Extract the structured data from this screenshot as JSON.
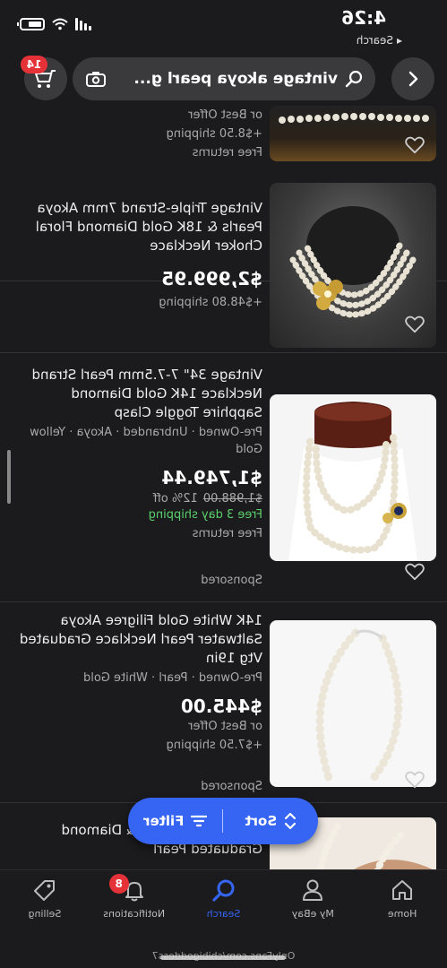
{
  "status": {
    "time": "4:26",
    "back_app": "Search"
  },
  "search": {
    "query": "vintage akoya pearl g...",
    "cart_count": "14"
  },
  "listings": [
    {
      "title": "",
      "price": "",
      "offer": "or Best Offer",
      "shipping": "+$8.50 shipping",
      "returns": "Free returns"
    },
    {
      "title": "Vintage Triple-Strand 7mm Akoya Pearls & 18K Gold Diamond Floral Choker Necklace",
      "price": "$2,999.95",
      "shipping": "+$48.80 shipping"
    },
    {
      "title": "Vintage 34\" 7-7.5mm Pearl Strand Necklace 14K Gold Diamond Sapphire Toggle Clasp",
      "meta": "Pre-Owned · Unbranded · Akoya · Yellow Gold",
      "price": "$1,749.44",
      "original_price": "$1,988.00",
      "discount": "12% off",
      "shipping": "Free 3 day shipping",
      "returns": "Free returns",
      "sponsored": "Sponsored"
    },
    {
      "title": "14K White Gold Filigree Akoya Saltwater Pearl Necklace Graduated Vtg 19in",
      "meta": "Pre-Owned · Pearl · White Gold",
      "price": "$445.00",
      "offer": "or Best Offer",
      "shipping": "+$7.50 shipping",
      "sponsored": "Sponsored"
    },
    {
      "title": "...14kt White Gold & Diamond Graduated Pearl"
    }
  ],
  "fab": {
    "sort": "Sort",
    "filter": "Filter"
  },
  "nav": {
    "home": "Home",
    "my_ebay": "My eBay",
    "search": "Search",
    "notifications": "Notifications",
    "notifications_count": "8",
    "selling": "Selling"
  },
  "watermark": "OnlyFans.com/chibigoddess7",
  "colors": {
    "accent": "#3665f3",
    "badge": "#e53238",
    "free_shipping": "#5bd16c",
    "background": "#1b1b1d"
  }
}
